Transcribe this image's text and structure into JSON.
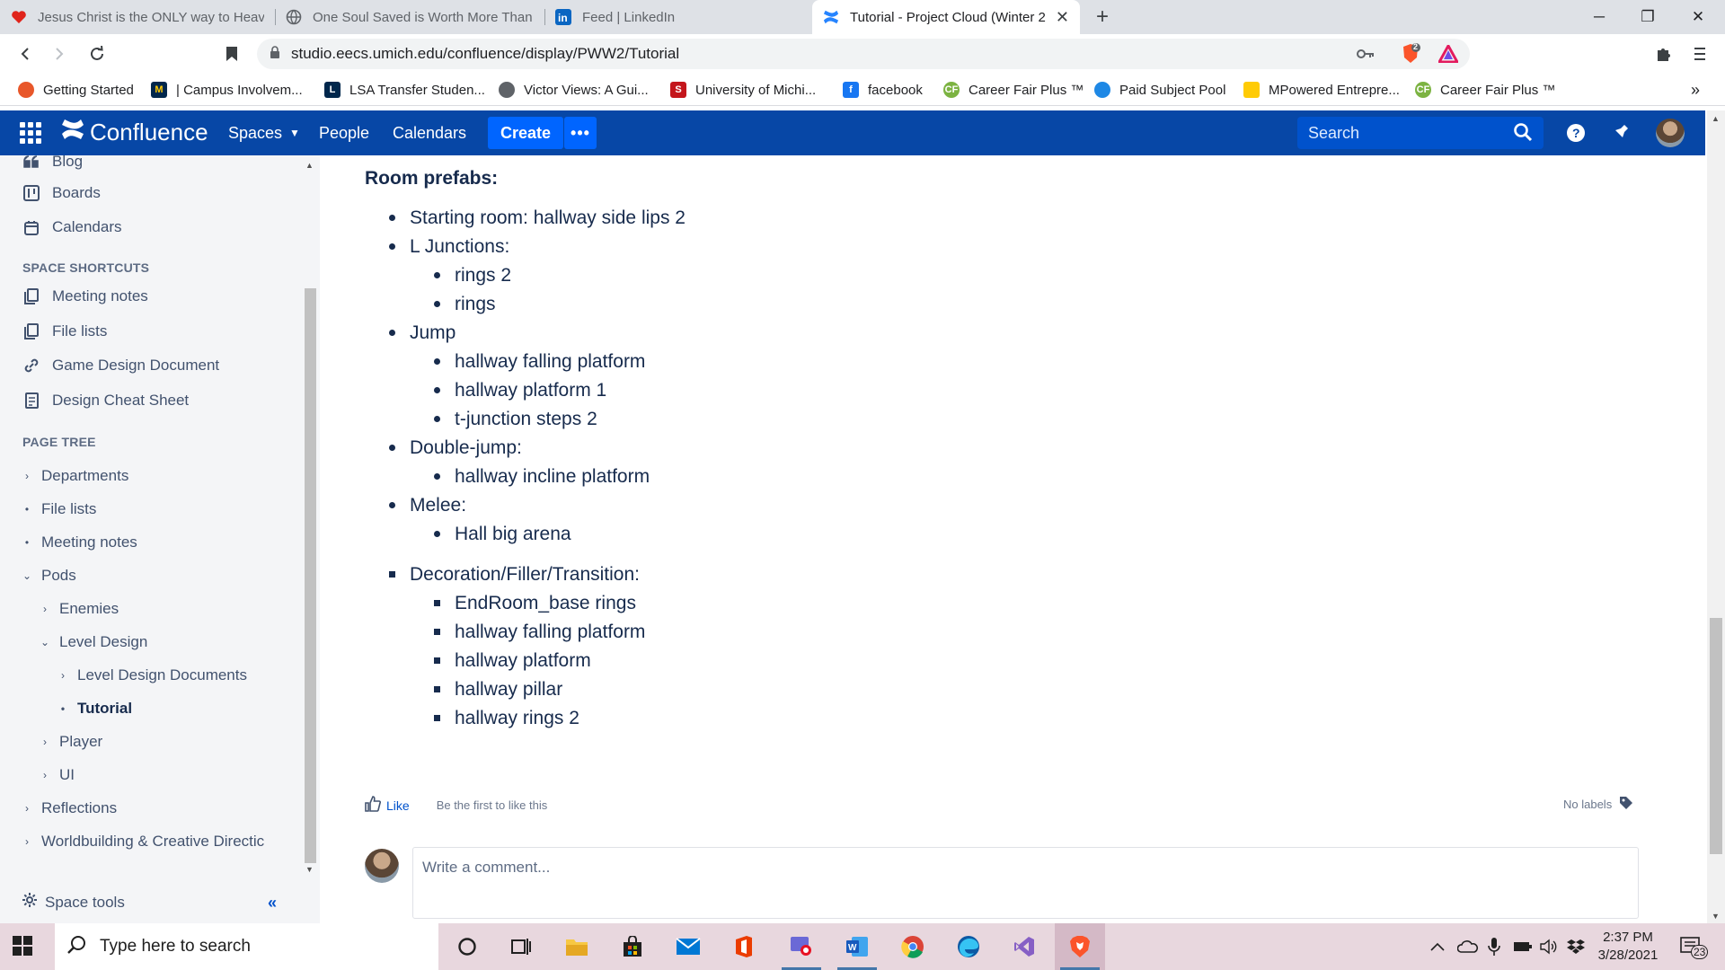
{
  "browser": {
    "tabs": [
      {
        "title": "Jesus Christ is the ONLY way to Heave",
        "favicon": "heart-icon"
      },
      {
        "title": "One Soul Saved is Worth More Than A",
        "favicon": "globe-icon"
      },
      {
        "title": "Feed | LinkedIn",
        "favicon": "linkedin-icon"
      },
      {
        "title": "Tutorial - Project Cloud (Winter 2",
        "favicon": "confluence-icon"
      }
    ],
    "url": "studio.eecs.umich.edu/confluence/display/PWW2/Tutorial",
    "brave_badge": "2",
    "bookmarks": [
      {
        "label": "Getting Started",
        "color": "#e8572a"
      },
      {
        "label": "| Campus Involvem...",
        "color": "#00274c"
      },
      {
        "label": "LSA Transfer Studen...",
        "color": "#00274c"
      },
      {
        "label": "Victor Views: A Gui...",
        "color": "#5f6368"
      },
      {
        "label": "University of Michi...",
        "color": "#c4161c"
      },
      {
        "label": "facebook",
        "color": "#1877f2"
      },
      {
        "label": "Career Fair Plus ™",
        "color": "#7cb342"
      },
      {
        "label": "Paid Subject Pool",
        "color": "#1e88e5"
      },
      {
        "label": "MPowered Entrepre...",
        "color": "#ffcb05"
      },
      {
        "label": "Career Fair Plus ™",
        "color": "#7cb342"
      }
    ]
  },
  "header": {
    "brand": "Confluence",
    "nav": [
      "Spaces",
      "People",
      "Calendars"
    ],
    "create": "Create",
    "more": "•••",
    "search_placeholder": "Search",
    "color": "#0747a6"
  },
  "sidebar": {
    "items": [
      {
        "label": "Blog",
        "icon": "quote-icon"
      },
      {
        "label": "Boards",
        "icon": "boards-icon"
      },
      {
        "label": "Calendars",
        "icon": "calendar-icon"
      }
    ],
    "shortcuts_heading": "SPACE SHORTCUTS",
    "shortcuts": [
      {
        "label": "Meeting notes",
        "icon": "copy-icon"
      },
      {
        "label": "File lists",
        "icon": "copy-icon"
      },
      {
        "label": "Game Design Document",
        "icon": "link-icon"
      },
      {
        "label": "Design Cheat Sheet",
        "icon": "document-icon"
      }
    ],
    "tree_heading": "PAGE TREE",
    "tree": [
      {
        "label": "Departments",
        "toggle": "›"
      },
      {
        "label": "File lists",
        "toggle": "•"
      },
      {
        "label": "Meeting notes",
        "toggle": "•"
      },
      {
        "label": "Pods",
        "toggle": "⌄"
      },
      {
        "label": "Enemies",
        "toggle": "›"
      },
      {
        "label": "Level Design",
        "toggle": "⌄"
      },
      {
        "label": "Level Design Documents",
        "toggle": "›"
      },
      {
        "label": "Tutorial",
        "toggle": "•"
      },
      {
        "label": "Player",
        "toggle": "›"
      },
      {
        "label": "UI",
        "toggle": "›"
      },
      {
        "label": "Reflections",
        "toggle": "›"
      },
      {
        "label": "Worldbuilding & Creative Directic",
        "toggle": "›"
      }
    ],
    "space_tools": "Space tools",
    "collapse": "«"
  },
  "content": {
    "section_title": "Room prefabs:",
    "list": [
      "Starting room: hallway side lips 2",
      "L Junctions:",
      "rings 2",
      "rings",
      "Jump",
      "hallway falling platform",
      "hallway platform 1",
      "t-junction steps 2",
      "Double-jump:",
      "hallway incline platform",
      "Melee:",
      "Hall big arena"
    ],
    "decoration_title": "Decoration/Filler/Transition:",
    "decoration_list": [
      "EndRoom_base rings",
      "hallway falling platform",
      "hallway platform",
      "hallway pillar",
      "hallway rings 2"
    ],
    "like": "Like",
    "like_hint": "Be the first to like this",
    "labels": "No labels",
    "comment_placeholder": "Write a comment..."
  },
  "taskbar": {
    "search_placeholder": "Type here to search",
    "time": "2:37 PM",
    "date": "3/28/2021",
    "notifications": "23"
  }
}
